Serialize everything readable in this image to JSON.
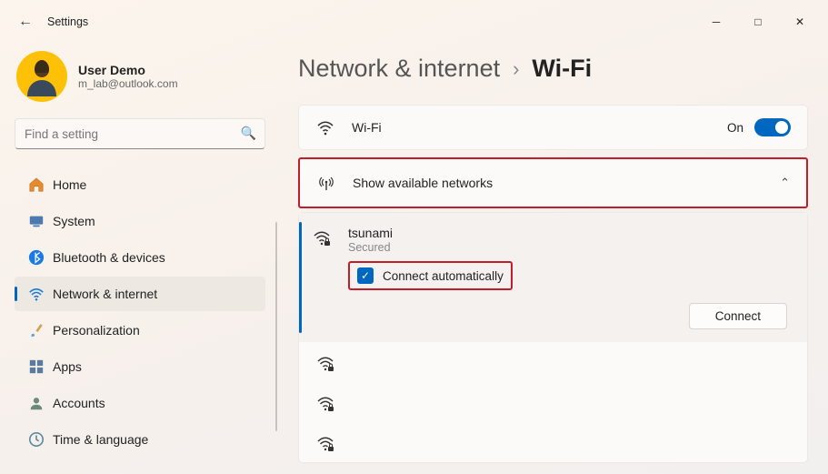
{
  "window": {
    "title": "Settings"
  },
  "user": {
    "name": "User Demo",
    "email": "m_lab@outlook.com"
  },
  "search": {
    "placeholder": "Find a setting"
  },
  "sidebar": {
    "items": [
      {
        "label": "Home"
      },
      {
        "label": "System"
      },
      {
        "label": "Bluetooth & devices"
      },
      {
        "label": "Network & internet"
      },
      {
        "label": "Personalization"
      },
      {
        "label": "Apps"
      },
      {
        "label": "Accounts"
      },
      {
        "label": "Time & language"
      }
    ]
  },
  "breadcrumb": {
    "parent": "Network & internet",
    "current": "Wi-Fi"
  },
  "wifi_card": {
    "title": "Wi-Fi",
    "state": "On"
  },
  "expand": {
    "label": "Show available networks"
  },
  "network": {
    "name": "tsunami",
    "security": "Secured",
    "auto_label": "Connect automatically",
    "connect_label": "Connect"
  }
}
